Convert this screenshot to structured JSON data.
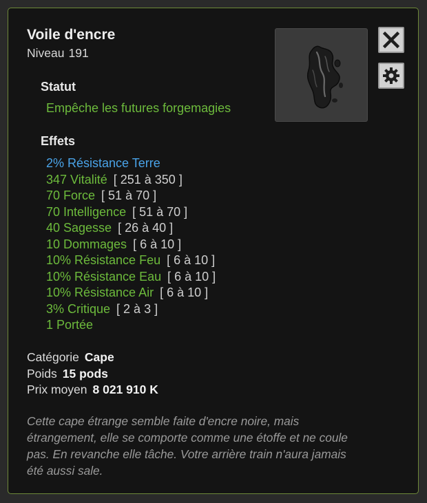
{
  "item": {
    "name": "Voile d'encre",
    "level_label": "Niveau",
    "level": "191"
  },
  "statut": {
    "title": "Statut",
    "text": "Empêche les futures forgemagies"
  },
  "effets": {
    "title": "Effets",
    "items": [
      {
        "name": "2% Résistance Terre",
        "range": "",
        "color": "#4aa3e8"
      },
      {
        "name": "347 Vitalité",
        "range": "[ 251 à 350 ]",
        "color": "#6dbb3c"
      },
      {
        "name": "70 Force",
        "range": "[ 51 à 70 ]",
        "color": "#6dbb3c"
      },
      {
        "name": "70 Intelligence",
        "range": "[ 51 à 70 ]",
        "color": "#6dbb3c"
      },
      {
        "name": "40 Sagesse",
        "range": "[ 26 à 40 ]",
        "color": "#6dbb3c"
      },
      {
        "name": "10 Dommages",
        "range": "[ 6 à 10 ]",
        "color": "#6dbb3c"
      },
      {
        "name": "10% Résistance Feu",
        "range": "[ 6 à 10 ]",
        "color": "#6dbb3c"
      },
      {
        "name": "10% Résistance Eau",
        "range": "[ 6 à 10 ]",
        "color": "#6dbb3c"
      },
      {
        "name": "10% Résistance Air",
        "range": "[ 6 à 10 ]",
        "color": "#6dbb3c"
      },
      {
        "name": "3% Critique",
        "range": "[ 2 à 3 ]",
        "color": "#6dbb3c"
      },
      {
        "name": "1 Portée",
        "range": "",
        "color": "#6dbb3c"
      }
    ]
  },
  "info": {
    "category_label": "Catégorie",
    "category": "Cape",
    "weight_label": "Poids",
    "weight": "15 pods",
    "price_label": "Prix moyen",
    "price": "8 021 910 K"
  },
  "description": "Cette cape étrange semble faite d'encre noire, mais étrangement, elle se comporte comme une étoffe et ne coule pas. En revanche elle tâche. Votre arrière train n'aura jamais été aussi sale.",
  "icons": {
    "close": "close-icon",
    "settings": "gear-icon",
    "item": "ink-cape-icon"
  },
  "colors": {
    "border": "#6f8a3a",
    "effect_green": "#6dbb3c",
    "effect_blue": "#4aa3e8"
  }
}
